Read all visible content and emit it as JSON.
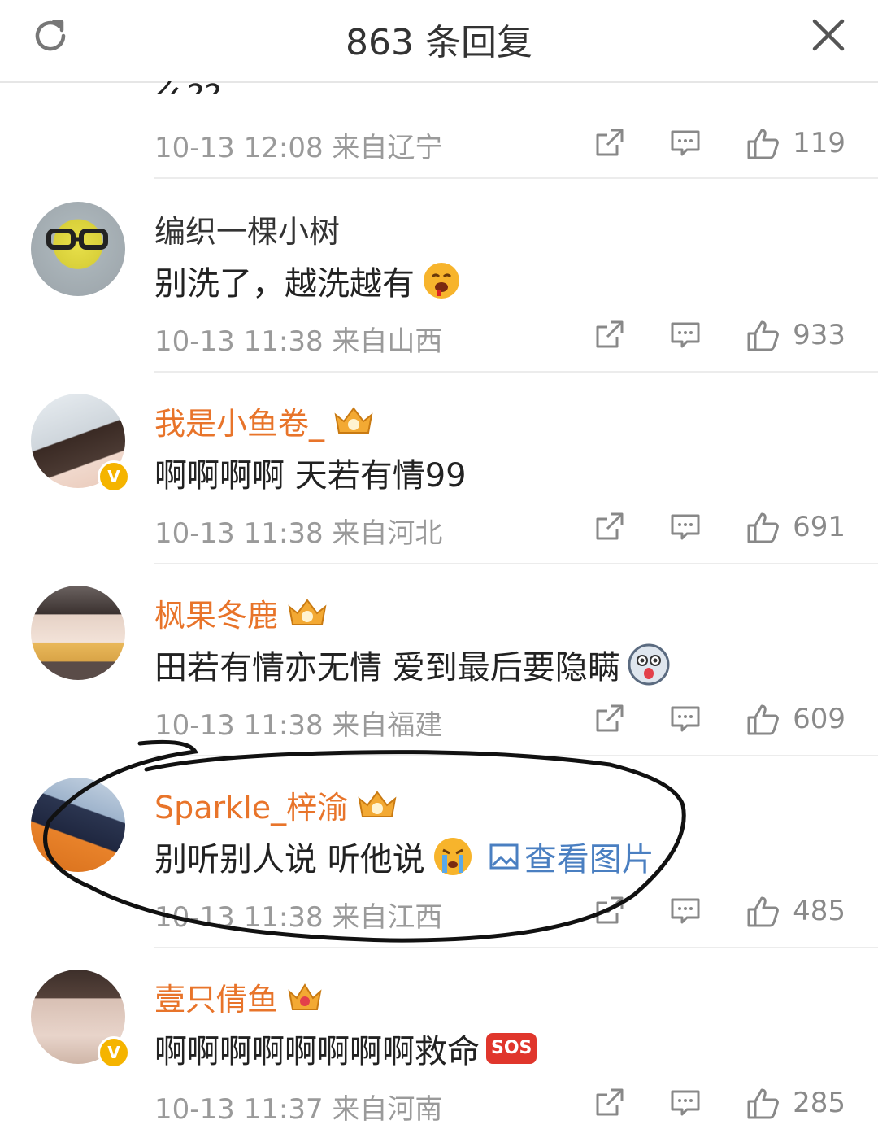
{
  "header": {
    "title": "863 条回复",
    "refresh_icon": "refresh-icon",
    "close_icon": "close-icon"
  },
  "partial_comment": {
    "text": "么??",
    "meta": "10-13 12:08 来自辽宁",
    "likes": "119"
  },
  "comments": [
    {
      "username": "编织一棵小树",
      "username_color": "#333333",
      "text": "别洗了，越洗越有",
      "emoji": "drooling-emoji",
      "meta": "10-13 11:38 来自山西",
      "likes": "933",
      "verified": false
    },
    {
      "username": "我是小鱼卷_",
      "username_color": "#e8742a",
      "crown_level": "6",
      "text": "啊啊啊啊 天若有情99",
      "meta": "10-13 11:38 来自河北",
      "likes": "691",
      "verified": true
    },
    {
      "username": "枫果冬鹿",
      "username_color": "#e8742a",
      "crown_level": "6",
      "text": "田若有情亦无情 爱到最后要隐瞒",
      "emoji": "husky-emoji",
      "meta": "10-13 11:38 来自福建",
      "likes": "609",
      "verified": false
    },
    {
      "username": "Sparkle_梓渝",
      "username_color": "#e8742a",
      "crown_level": "6",
      "text": "别听别人说 听他说",
      "emoji": "crying-emoji",
      "view_image": "查看图片",
      "meta": "10-13 11:38 来自江西",
      "likes": "485",
      "verified": false
    },
    {
      "username": "壹只倩鱼",
      "username_color": "#e8742a",
      "crown_level": "",
      "text": "啊啊啊啊啊啊啊啊救命",
      "sos": "SOS",
      "meta": "10-13 11:37 来自河南",
      "likes": "285",
      "verified": true
    }
  ],
  "icons": {
    "share": "share-icon",
    "comment": "comment-icon",
    "like": "thumbs-up-icon"
  },
  "colors": {
    "accent_orange": "#e8742a",
    "link_blue": "#4a7fc1",
    "meta_gray": "#9a9a9a",
    "badge_gold": "#f5b400"
  }
}
